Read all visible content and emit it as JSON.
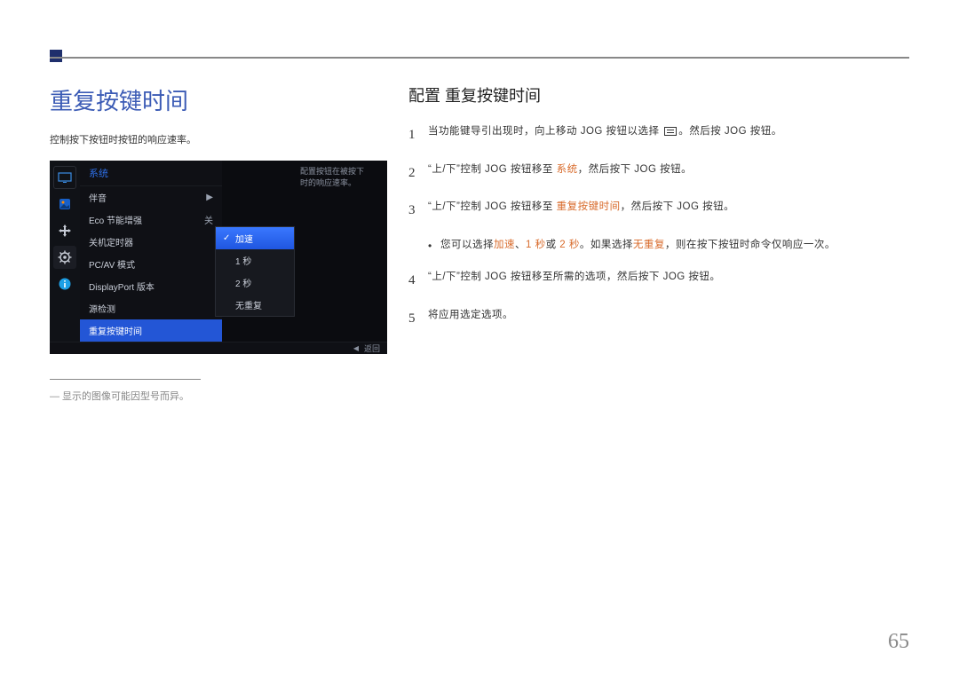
{
  "page": {
    "title": "重复按键时间",
    "subtitle": "控制按下按钮时按钮的响应速率。",
    "note": "― 显示的图像可能因型号而异。",
    "pageNumber": "65"
  },
  "osd": {
    "header": "系统",
    "desc_line1": "配置按钮在被按下",
    "desc_line2": "时的响应速率。",
    "items": [
      {
        "label": "伴音",
        "value": "",
        "arrow": "▶"
      },
      {
        "label": "Eco 节能增强",
        "value": "关",
        "arrow": ""
      },
      {
        "label": "关机定时器",
        "value": "",
        "arrow": ""
      },
      {
        "label": "PC/AV 模式",
        "value": "",
        "arrow": ""
      },
      {
        "label": "DisplayPort 版本",
        "value": "",
        "arrow": ""
      },
      {
        "label": "源检测",
        "value": "",
        "arrow": ""
      },
      {
        "label": "重复按键时间",
        "value": "",
        "arrow": ""
      }
    ],
    "dropdown": [
      {
        "label": "加速",
        "selected": true
      },
      {
        "label": "1 秒",
        "selected": false
      },
      {
        "label": "2 秒",
        "selected": false
      },
      {
        "label": "无重复",
        "selected": false
      }
    ],
    "footer_label": "返回"
  },
  "right": {
    "heading": "配置 重复按键时间",
    "step1_a": "当功能键导引出现时，向上移动 JOG 按钮以选择 ",
    "step1_b": "。然后按 JOG 按钮。",
    "step2_a": "“上/下”控制 JOG 按钮移至 ",
    "step2_hl": "系统",
    "step2_b": "，然后按下 JOG 按钮。",
    "step3_a": "“上/下”控制 JOG 按钮移至 ",
    "step3_hl": "重复按键时间",
    "step3_b": "，然后按下 JOG 按钮。",
    "bullet_a": "您可以选择",
    "bullet_h1": "加速",
    "bullet_s1": "、",
    "bullet_h2": "1 秒",
    "bullet_s2": "或 ",
    "bullet_h3": "2 秒",
    "bullet_s3": "。如果选择",
    "bullet_h4": "无重复",
    "bullet_s4": "，则在按下按钮时命令仅响应一次。",
    "step4": "“上/下”控制 JOG 按钮移至所需的选项，然后按下 JOG 按钮。",
    "step5": "将应用选定选项。"
  }
}
